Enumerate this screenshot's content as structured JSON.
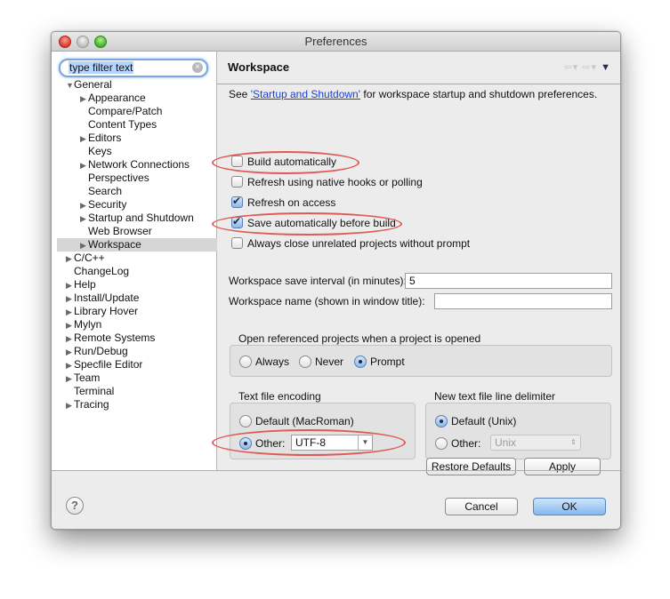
{
  "window": {
    "title": "Preferences"
  },
  "filter": {
    "value": "type filter text",
    "clear_icon": "×"
  },
  "tree": {
    "expanded_glyph": "▼",
    "collapsed_glyph": "▶",
    "items": [
      {
        "label": "General",
        "level": 0,
        "toggle": "expanded"
      },
      {
        "label": "Appearance",
        "level": 1,
        "toggle": "collapsed"
      },
      {
        "label": "Compare/Patch",
        "level": 1,
        "toggle": "none"
      },
      {
        "label": "Content Types",
        "level": 1,
        "toggle": "none"
      },
      {
        "label": "Editors",
        "level": 1,
        "toggle": "collapsed"
      },
      {
        "label": "Keys",
        "level": 1,
        "toggle": "none"
      },
      {
        "label": "Network Connections",
        "level": 1,
        "toggle": "collapsed"
      },
      {
        "label": "Perspectives",
        "level": 1,
        "toggle": "none"
      },
      {
        "label": "Search",
        "level": 1,
        "toggle": "none"
      },
      {
        "label": "Security",
        "level": 1,
        "toggle": "collapsed"
      },
      {
        "label": "Startup and Shutdown",
        "level": 1,
        "toggle": "collapsed"
      },
      {
        "label": "Web Browser",
        "level": 1,
        "toggle": "none"
      },
      {
        "label": "Workspace",
        "level": 1,
        "toggle": "collapsed",
        "selected": true
      },
      {
        "label": "C/C++",
        "level": 0,
        "toggle": "collapsed"
      },
      {
        "label": "ChangeLog",
        "level": 0,
        "toggle": "none"
      },
      {
        "label": "Help",
        "level": 0,
        "toggle": "collapsed"
      },
      {
        "label": "Install/Update",
        "level": 0,
        "toggle": "collapsed"
      },
      {
        "label": "Library Hover",
        "level": 0,
        "toggle": "collapsed"
      },
      {
        "label": "Mylyn",
        "level": 0,
        "toggle": "collapsed"
      },
      {
        "label": "Remote Systems",
        "level": 0,
        "toggle": "collapsed"
      },
      {
        "label": "Run/Debug",
        "level": 0,
        "toggle": "collapsed"
      },
      {
        "label": "Specfile Editor",
        "level": 0,
        "toggle": "collapsed"
      },
      {
        "label": "Team",
        "level": 0,
        "toggle": "collapsed"
      },
      {
        "label": "Terminal",
        "level": 0,
        "toggle": "none"
      },
      {
        "label": "Tracing",
        "level": 0,
        "toggle": "collapsed"
      }
    ]
  },
  "page": {
    "title": "Workspace",
    "nav": {
      "back": "⇦▾",
      "forward": "⇨▾",
      "menu": "▼"
    },
    "intro_before": "See ",
    "intro_link": "'Startup and Shutdown'",
    "intro_after": " for workspace startup and shutdown preferences."
  },
  "checkboxes": [
    {
      "label": "Build automatically",
      "checked": false,
      "highlighted": true
    },
    {
      "label": "Refresh using native hooks or polling",
      "checked": false
    },
    {
      "label": "Refresh on access",
      "checked": true
    },
    {
      "label": "Save automatically before build",
      "checked": true,
      "highlighted": true
    },
    {
      "label": "Always close unrelated projects without prompt",
      "checked": false
    }
  ],
  "fields": {
    "save_interval_label": "Workspace save interval (in minutes):",
    "save_interval_value": "5",
    "workspace_name_label": "Workspace name (shown in window title):",
    "workspace_name_value": ""
  },
  "open_referenced": {
    "label": "Open referenced projects when a project is opened",
    "options": [
      "Always",
      "Never",
      "Prompt"
    ],
    "selected": "Prompt"
  },
  "encoding": {
    "label": "Text file encoding",
    "default_label": "Default (MacRoman)",
    "other_label": "Other:",
    "selected": "Other",
    "other_value": "UTF-8",
    "dropdown_glyph": "▼"
  },
  "line_delimiter": {
    "label": "New text file line delimiter",
    "default_label": "Default (Unix)",
    "other_label": "Other:",
    "selected": "Default",
    "other_value": "Unix",
    "dropdown_glyph": "⇕"
  },
  "buttons": {
    "restore_defaults": "Restore Defaults",
    "apply": "Apply",
    "cancel": "Cancel",
    "ok": "OK",
    "help": "?"
  },
  "annotation_color": "#e05a55"
}
